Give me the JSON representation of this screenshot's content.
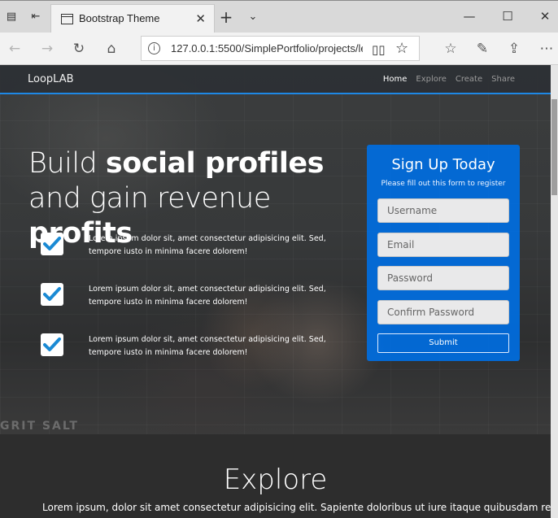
{
  "browser": {
    "tab_title": "Bootstrap Theme",
    "url": "127.0.0.1:5500/SimplePortfolio/projects/le"
  },
  "navbar": {
    "brand": "LoopLAB",
    "links": [
      {
        "label": "Home",
        "active": true
      },
      {
        "label": "Explore",
        "active": false
      },
      {
        "label": "Create",
        "active": false
      },
      {
        "label": "Share",
        "active": false
      }
    ]
  },
  "hero": {
    "headline_part1": "Build ",
    "headline_bold1": "social profiles",
    "headline_part2": " and gain revenue ",
    "headline_bold2": "profits",
    "features": [
      "Lorem ipsum dolor sit, amet consectetur adipisicing elit. Sed, tempore iusto in minima facere dolorem!",
      "Lorem ipsum dolor sit, amet consectetur adipisicing elit. Sed, tempore iusto in minima facere dolorem!",
      "Lorem ipsum dolor sit, amet consectetur adipisicing elit. Sed, tempore iusto in minima facere dolorem!"
    ],
    "sign_text": "GRIT SALT"
  },
  "signup": {
    "title": "Sign Up Today",
    "subtitle": "Please fill out this form to register",
    "username_placeholder": "Username",
    "email_placeholder": "Email",
    "password_placeholder": "Password",
    "confirm_placeholder": "Confirm Password",
    "submit_label": "Submit"
  },
  "explore": {
    "title": "Explore",
    "text": "Lorem ipsum, dolor sit amet consectetur adipisicing elit. Sapiente doloribus ut iure itaque quibusdam rem"
  },
  "colors": {
    "accent": "#1e88e5",
    "signup_bg": "#006ee1",
    "check": "#1a8ad4"
  }
}
